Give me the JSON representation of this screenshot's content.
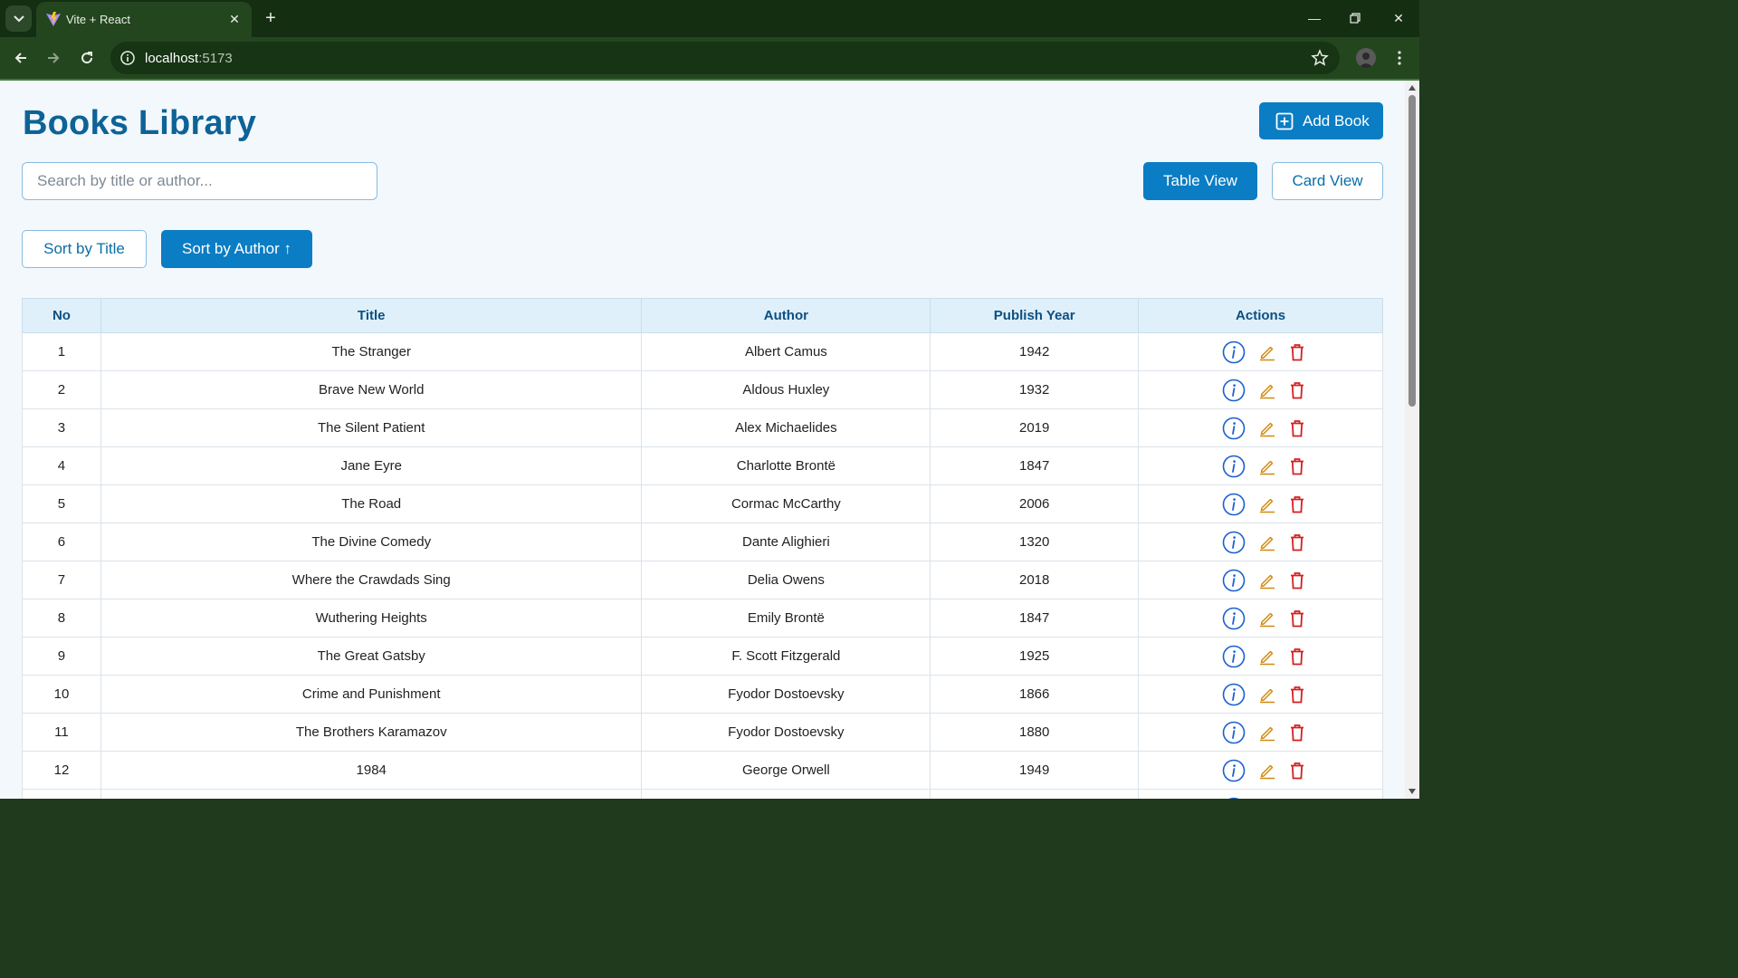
{
  "browser": {
    "tab_title": "Vite + React",
    "url_host": "localhost",
    "url_port": ":5173"
  },
  "page": {
    "title": "Books Library",
    "add_button": "Add Book",
    "search_placeholder": "Search by title or author...",
    "table_view": "Table View",
    "card_view": "Card View",
    "sort_title": "Sort by Title",
    "sort_author": "Sort by Author ↑"
  },
  "table": {
    "headers": [
      "No",
      "Title",
      "Author",
      "Publish Year",
      "Actions"
    ],
    "rows": [
      {
        "no": "1",
        "title": "The Stranger",
        "author": "Albert Camus",
        "year": "1942"
      },
      {
        "no": "2",
        "title": "Brave New World",
        "author": "Aldous Huxley",
        "year": "1932"
      },
      {
        "no": "3",
        "title": "The Silent Patient",
        "author": "Alex Michaelides",
        "year": "2019"
      },
      {
        "no": "4",
        "title": "Jane Eyre",
        "author": "Charlotte Brontë",
        "year": "1847"
      },
      {
        "no": "5",
        "title": "The Road",
        "author": "Cormac McCarthy",
        "year": "2006"
      },
      {
        "no": "6",
        "title": "The Divine Comedy",
        "author": "Dante Alighieri",
        "year": "1320"
      },
      {
        "no": "7",
        "title": "Where the Crawdads Sing",
        "author": "Delia Owens",
        "year": "2018"
      },
      {
        "no": "8",
        "title": "Wuthering Heights",
        "author": "Emily Brontë",
        "year": "1847"
      },
      {
        "no": "9",
        "title": "The Great Gatsby",
        "author": "F. Scott Fitzgerald",
        "year": "1925"
      },
      {
        "no": "10",
        "title": "Crime and Punishment",
        "author": "Fyodor Dostoevsky",
        "year": "1866"
      },
      {
        "no": "11",
        "title": "The Brothers Karamazov",
        "author": "Fyodor Dostoevsky",
        "year": "1880"
      },
      {
        "no": "12",
        "title": "1984",
        "author": "George Orwell",
        "year": "1949"
      },
      {
        "no": "",
        "title": "",
        "author": "",
        "year": ""
      }
    ]
  },
  "colors": {
    "primary": "#0a7dc4",
    "title": "#0d6396",
    "info_icon": "#1a5fd0",
    "edit_icon": "#d08a10",
    "delete_icon": "#d42020"
  },
  "icons": {
    "add": "plus-square-icon",
    "info": "info-circle-icon",
    "edit": "pencil-icon",
    "delete": "trash-icon"
  }
}
